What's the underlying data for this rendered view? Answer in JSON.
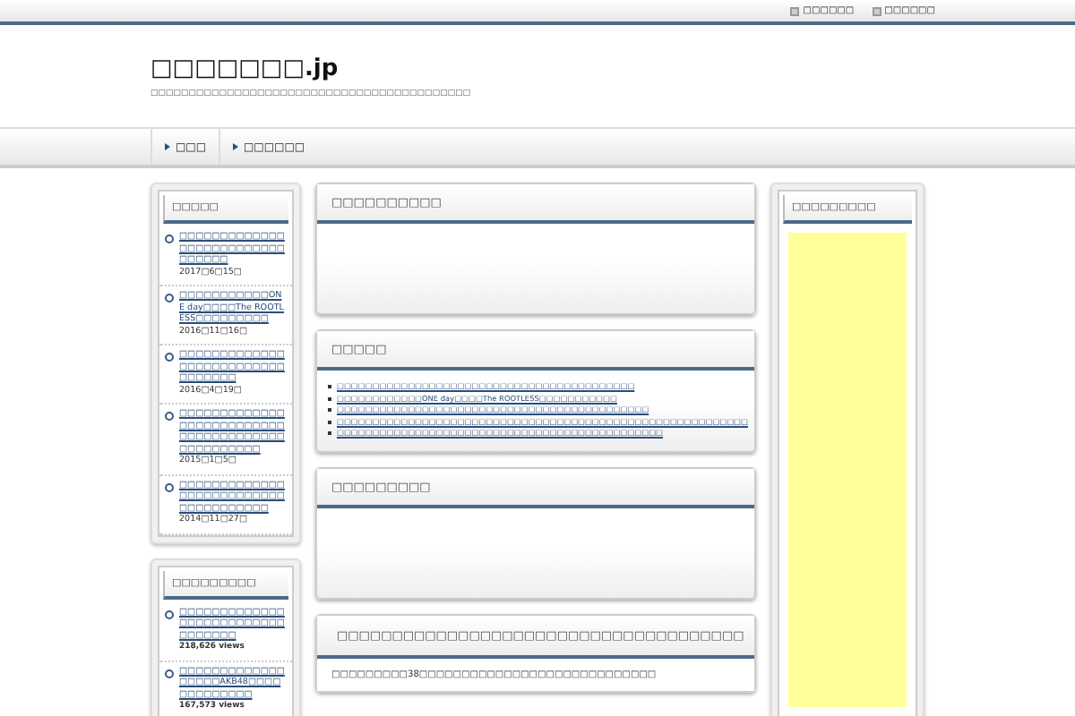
{
  "top_links": [
    "□□□□□□",
    "□□□□□□"
  ],
  "site": {
    "title": "□□□□□□□.jp",
    "tagline": "□□□□□□□□□□□□□□□□□□□□□□□□□□□□□□□□□□□□□□□□□□"
  },
  "nav": [
    "□□□",
    "□□□□□□"
  ],
  "left_widgets": [
    {
      "title": "□□□□□",
      "items": [
        {
          "link": "□□□□□□□□□□□□□□□□□□□□□□□□□□□□□□□□",
          "date": "2017□6□15□"
        },
        {
          "link": "□□□□□□□□□□□ONE day□□□□The ROOTLESS□□□□□□□□□",
          "date": "2016□11□16□"
        },
        {
          "link": "□□□□□□□□□□□□□□□□□□□□□□□□□□□□□□□□□",
          "date": "2016□4□19□"
        },
        {
          "link": "□□□□□□□□□□□□□□□□□□□□□□□□□□□□□□□□□□□□□□□□□□□□□□□□□",
          "date": "2015□1□5□"
        },
        {
          "link": "□□□□□□□□□□□□□□□□□□□□□□□□□□□□□□□□□□□□□",
          "date": "2014□11□27□"
        }
      ]
    },
    {
      "title": "□□□□□□□□□",
      "items": [
        {
          "link": "□□□□□□□□□□□□□□□□□□□□□□□□□□□□□□□□□",
          "views": "218,626 views"
        },
        {
          "link": "□□□□□□□□□□□□□□□□□□AKB48□□□□□□□□□□□□□",
          "views": "167,573 views"
        }
      ]
    }
  ],
  "main_boxes": [
    {
      "kind": "empty",
      "title": "□□□□□□□□□□"
    },
    {
      "kind": "list",
      "title": "□□□□□",
      "links": [
        "□□□□□□□□□□□□□□□□□□□□□□□□□□□□□□□□□□□□□□□□□□",
        "□□□□□□□□□□□□ONE day□□□□The ROOTLESS□□□□□□□□□□□",
        "□□□□□□□□□□□□□□□□□□□□□□□□□□□□□□□□□□□□□□□□□□□□",
        "□□□□□□□□□□□□□□□□□□□□□□□□□□□□□□□□□□□□□□□□□□□□□□□□□□□□□□□□□□",
        "□□□□□□□□□□□□□□□□□□□□□□□□□□□□□□□□□□□□□□□□□□□□□□"
      ]
    },
    {
      "kind": "empty",
      "title": "□□□□□□□□□"
    },
    {
      "kind": "post",
      "title": "□□□□□□□□□□□□□□□□□□□□□□□□□□□□□□□□□□□□□",
      "text": "□□□□□□□□□38□□□□□□□□□□□□□□□□□□□□□□□□□□□□"
    }
  ],
  "right_widget": {
    "title": "□□□□□□□□□"
  }
}
